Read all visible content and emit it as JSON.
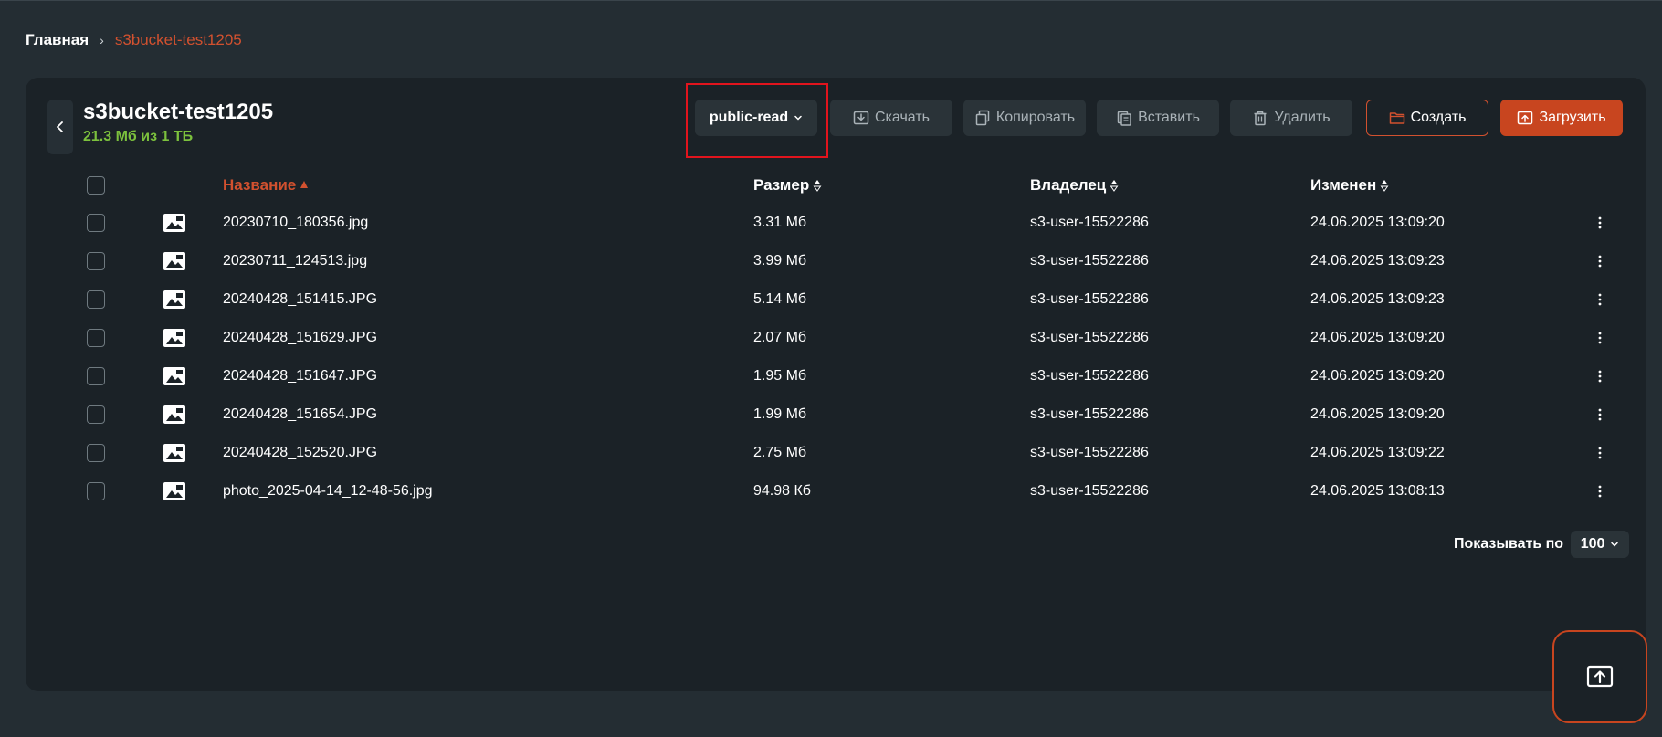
{
  "breadcrumb": {
    "home": "Главная",
    "separator": "›",
    "current": "s3bucket-test1205"
  },
  "bucket": {
    "name": "s3bucket-test1205",
    "usage": "21.3 Мб из 1 ТБ"
  },
  "toolbar": {
    "acl": "public-read",
    "download": "Скачать",
    "copy": "Копировать",
    "paste": "Вставить",
    "delete": "Удалить",
    "create": "Создать",
    "upload": "Загрузить"
  },
  "table": {
    "columns": {
      "name": "Название",
      "size": "Размер",
      "owner": "Владелец",
      "modified": "Изменен"
    },
    "rows": [
      {
        "name": "20230710_180356.jpg",
        "size": "3.31 Мб",
        "owner": "s3-user-15522286",
        "modified": "24.06.2025 13:09:20"
      },
      {
        "name": "20230711_124513.jpg",
        "size": "3.99 Мб",
        "owner": "s3-user-15522286",
        "modified": "24.06.2025 13:09:23"
      },
      {
        "name": "20240428_151415.JPG",
        "size": "5.14 Мб",
        "owner": "s3-user-15522286",
        "modified": "24.06.2025 13:09:23"
      },
      {
        "name": "20240428_151629.JPG",
        "size": "2.07 Мб",
        "owner": "s3-user-15522286",
        "modified": "24.06.2025 13:09:20"
      },
      {
        "name": "20240428_151647.JPG",
        "size": "1.95 Мб",
        "owner": "s3-user-15522286",
        "modified": "24.06.2025 13:09:20"
      },
      {
        "name": "20240428_151654.JPG",
        "size": "1.99 Мб",
        "owner": "s3-user-15522286",
        "modified": "24.06.2025 13:09:20"
      },
      {
        "name": "20240428_152520.JPG",
        "size": "2.75 Мб",
        "owner": "s3-user-15522286",
        "modified": "24.06.2025 13:09:22"
      },
      {
        "name": "photo_2025-04-14_12-48-56.jpg",
        "size": "94.98 Кб",
        "owner": "s3-user-15522286",
        "modified": "24.06.2025 13:08:13"
      }
    ]
  },
  "pagination": {
    "label": "Показывать по",
    "value": "100"
  },
  "colors": {
    "accent": "#c8451f",
    "usage": "#7cc13d",
    "highlight": "#e2141d"
  },
  "icons": {
    "file": "image-file-icon",
    "menu": "kebab-menu-icon",
    "upload_fab": "upload-icon"
  }
}
